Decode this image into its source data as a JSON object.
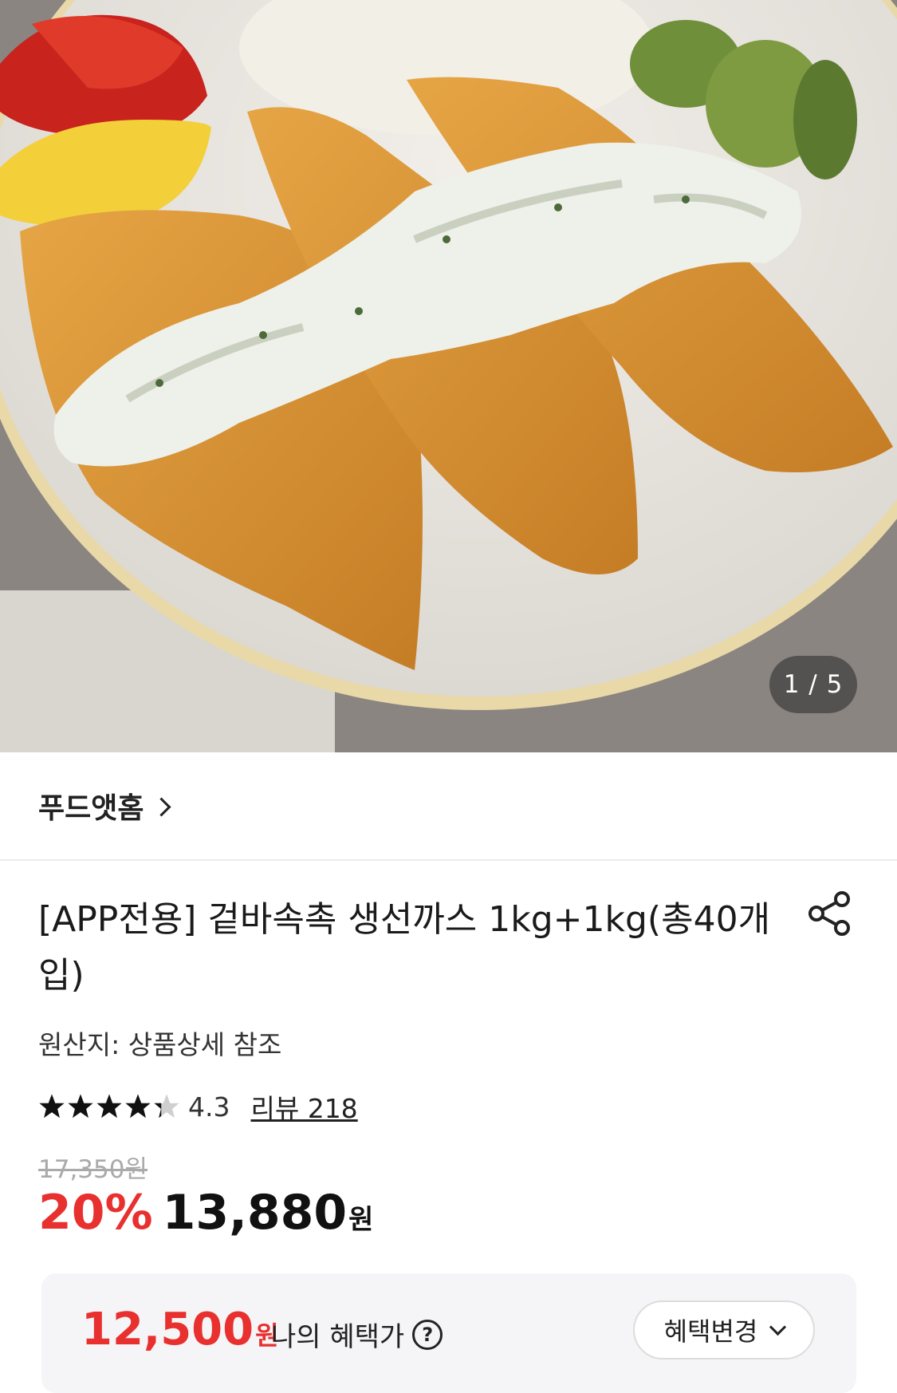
{
  "hero": {
    "image_alt": "생선까스 with tartar sauce",
    "counter": "1 / 5"
  },
  "seller": {
    "name": "푸드앳홈"
  },
  "product": {
    "title": "[APP전용] 겉바속촉 생선까스 1kg+1kg(총40개입)",
    "origin": "원산지: 상품상세 참조",
    "rating": "4.3",
    "rating_fraction": 0.86,
    "review_link": "리뷰 218",
    "original_price": "17,350원",
    "discount": "20%",
    "sale_price": "13,880",
    "currency": "원"
  },
  "benefit": {
    "price": "12,500",
    "currency": "원",
    "label": "나의 혜택가",
    "help_icon": "?",
    "change_button": "혜택변경"
  },
  "colors": {
    "accent_red": "#e8302f",
    "star": "#111111",
    "benefit_bg": "#f5f5f7"
  }
}
